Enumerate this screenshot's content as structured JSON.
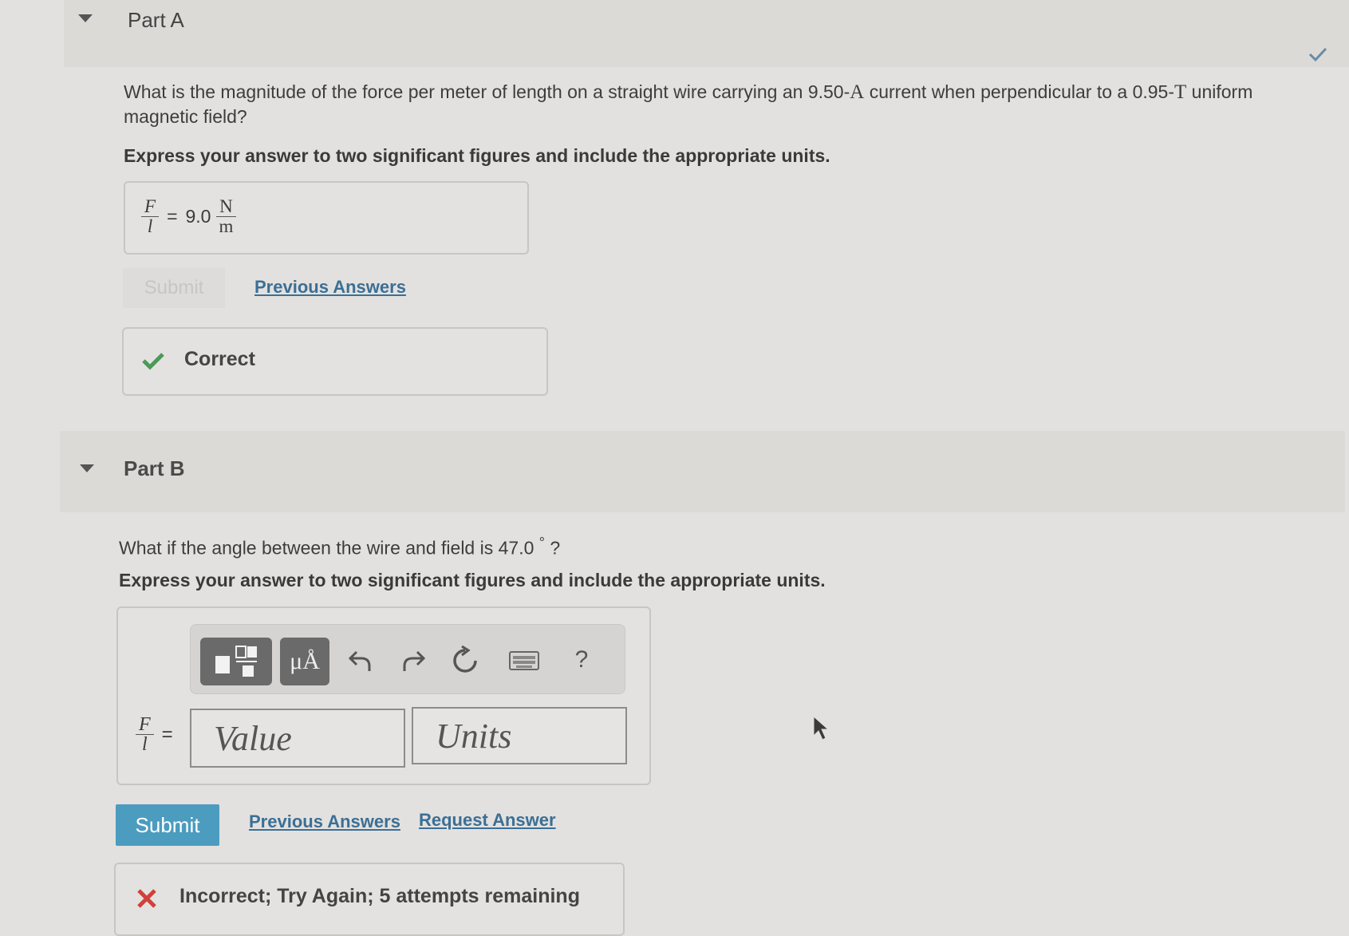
{
  "part_a": {
    "title": "Part A",
    "question_start": "What is the magnitude of the force per meter of length on a straight wire carrying an 9.50-",
    "current_unit": "A",
    "question_mid": " current when perpendicular to a 0.95-",
    "field_unit": "T",
    "question_end": " uniform",
    "question_line2": "magnetic field?",
    "instruction": "Express your answer to two significant figures and include the appropriate units.",
    "answer": {
      "lhs_num": "F",
      "lhs_den": "l",
      "equals": "=",
      "value": "9.0",
      "unit_num": "N",
      "unit_den": "m"
    },
    "submit_label": "Submit",
    "previous_answers": "Previous Answers",
    "feedback": "Correct"
  },
  "part_b": {
    "title": "Part B",
    "question_start": "What if the angle between the wire and field is 47.0 ",
    "degree": "°",
    "question_end": " ?",
    "instruction": "Express your answer to two significant figures and include the appropriate units.",
    "toolbar": {
      "units_symbol": "μÅ",
      "help": "?"
    },
    "answer": {
      "lhs_num": "F",
      "lhs_den": "l",
      "equals": "=",
      "value_placeholder": "Value",
      "units_placeholder": "Units"
    },
    "submit_label": "Submit",
    "previous_answers": "Previous Answers",
    "request_answer": "Request Answer",
    "feedback": "Incorrect; Try Again; 5 attempts remaining"
  },
  "colors": {
    "correct_check": "#4a9a58",
    "incorrect_x": "#d0413a",
    "link": "#3b6f95",
    "submit": "#4b9cbf"
  }
}
